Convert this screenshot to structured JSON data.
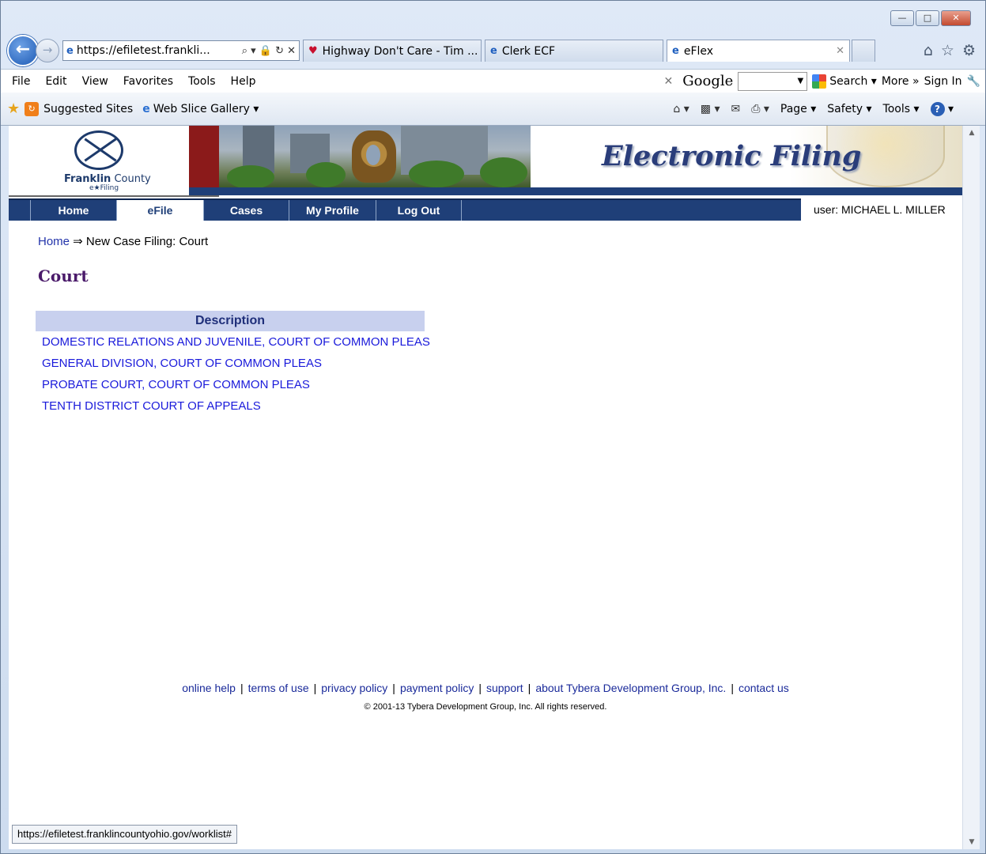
{
  "browser": {
    "address": "https://efiletest.frankli...",
    "address_icons": "⌕ ▾ 🔒 ↻ ✕",
    "tabs": [
      {
        "icon": "€ə",
        "label": "Highway Don't Care - Tim ..."
      },
      {
        "icon": "€ə",
        "label": "Clerk ECF"
      },
      {
        "icon": "€ə",
        "label": "eFlex"
      }
    ],
    "menu": [
      "File",
      "Edit",
      "View",
      "Favorites",
      "Tools",
      "Help"
    ],
    "google": {
      "logo": "Google",
      "search_label": "Search ▾",
      "more_label": "More »",
      "signin_label": "Sign In"
    },
    "favorites": {
      "suggested": "Suggested Sites",
      "web_slice": "Web Slice Gallery ▾"
    },
    "command_bar": {
      "page": "Page ▾",
      "safety": "Safety ▾",
      "tools": "Tools ▾"
    },
    "status_url": "https://efiletest.franklincountyohio.gov/worklist#"
  },
  "site": {
    "logo_main": "Franklin",
    "logo_county": "County",
    "logo_sub": "e★Filing",
    "title": "Electronic Filing",
    "nav": [
      "Home",
      "eFile",
      "Cases",
      "My Profile",
      "Log Out"
    ],
    "user": "user: MICHAEL L. MILLER"
  },
  "breadcrumb": {
    "home": "Home",
    "separator": " ⇒ ",
    "current": "New Case Filing: Court"
  },
  "page_title": "Court",
  "table": {
    "header": "Description",
    "rows": [
      "DOMESTIC RELATIONS AND JUVENILE, COURT OF COMMON PLEAS",
      "GENERAL DIVISION, COURT OF COMMON PLEAS",
      "PROBATE COURT, COURT OF COMMON PLEAS",
      "TENTH DISTRICT COURT OF APPEALS"
    ]
  },
  "footer": {
    "links": [
      "online help",
      "terms of use",
      "privacy policy",
      "payment policy",
      "support",
      "about Tybera Development Group, Inc.",
      "contact us"
    ],
    "copyright": "© 2001-13 Tybera Development Group, Inc. All rights reserved."
  },
  "colors": {
    "nav_bg": "#1f3f78",
    "title_purple": "#4a1a6a",
    "link_blue": "#1a1adb"
  }
}
